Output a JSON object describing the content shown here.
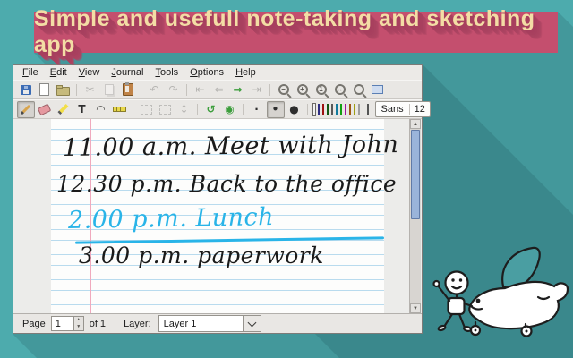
{
  "banner": {
    "text": "Simple and usefull note-taking and sketching app"
  },
  "colors_theme": {
    "background": "#4dabad",
    "banner": "#c44f6e",
    "banner_text": "#f3dda5",
    "ink_black": "#1a1a1a",
    "ink_cyan": "#29b4e8",
    "paper_line": "#b9dbee",
    "paper_margin": "#f0a9bd"
  },
  "window": {
    "menubar": {
      "items": [
        "File",
        "Edit",
        "View",
        "Journal",
        "Tools",
        "Options",
        "Help"
      ]
    },
    "toolbar_main": {
      "groups": [
        [
          "save",
          "new-file",
          "open"
        ],
        [
          "cut",
          "copy",
          "paste"
        ],
        [
          "undo",
          "redo"
        ],
        [
          "first-page",
          "previous-page",
          "next-page",
          "last-page"
        ],
        [
          "zoom-out",
          "zoom-in",
          "normal-size",
          "page-width",
          "set-zoom",
          "full-screen"
        ]
      ],
      "disabled": [
        "cut",
        "copy",
        "undo",
        "redo",
        "first-page",
        "previous-page",
        "last-page"
      ]
    },
    "toolbar_tools": {
      "groups": [
        [
          "pen",
          "eraser",
          "highlighter",
          "text",
          "shape-recognizer",
          "ruler"
        ],
        [
          "select-region",
          "select-rectangle",
          "vertical-space"
        ],
        [
          "default",
          "pen-options"
        ],
        [
          "thickness-fine",
          "thickness-medium",
          "thickness-thick"
        ]
      ],
      "disabled": [
        "select-region",
        "select-rectangle",
        "vertical-space"
      ],
      "active": [
        "pen",
        "thickness-medium"
      ]
    },
    "colors": {
      "selected": "black",
      "swatches": [
        {
          "name": "black",
          "hex": "#000000"
        },
        {
          "name": "blue",
          "hex": "#3333cc"
        },
        {
          "name": "red",
          "hex": "#ff0000"
        },
        {
          "name": "green",
          "hex": "#008000"
        },
        {
          "name": "gray",
          "hex": "#808080"
        },
        {
          "name": "light-blue",
          "hex": "#00c0ff"
        },
        {
          "name": "light-green",
          "hex": "#00ff00"
        },
        {
          "name": "magenta",
          "hex": "#ff00ff"
        },
        {
          "name": "orange",
          "hex": "#ff8000"
        },
        {
          "name": "yellow",
          "hex": "#ffff00"
        },
        {
          "name": "white",
          "hex": "#ffffff"
        },
        {
          "name": "color-chooser",
          "hex": "#000000"
        }
      ]
    },
    "font_button": {
      "family": "Sans",
      "size": "12"
    },
    "notes": {
      "lines": [
        {
          "text": "11.00 a.m. Meet with John",
          "color": "#1a1a1a"
        },
        {
          "text": "12.30 p.m. Back to the office",
          "color": "#1a1a1a"
        },
        {
          "text": "2.00 p.m. Lunch",
          "color": "#29b4e8",
          "struck": true
        },
        {
          "text": "3.00 p.m. paperwork",
          "color": "#1a1a1a"
        }
      ],
      "strike_color": "#29b4e8"
    },
    "statusbar": {
      "page_label": "Page",
      "page_value": "1",
      "of_text": "of 1",
      "layer_label": "Layer:",
      "layer_value": "Layer 1"
    }
  },
  "doodle": {
    "subject": "stick figure waving beside cartoon airplane"
  }
}
